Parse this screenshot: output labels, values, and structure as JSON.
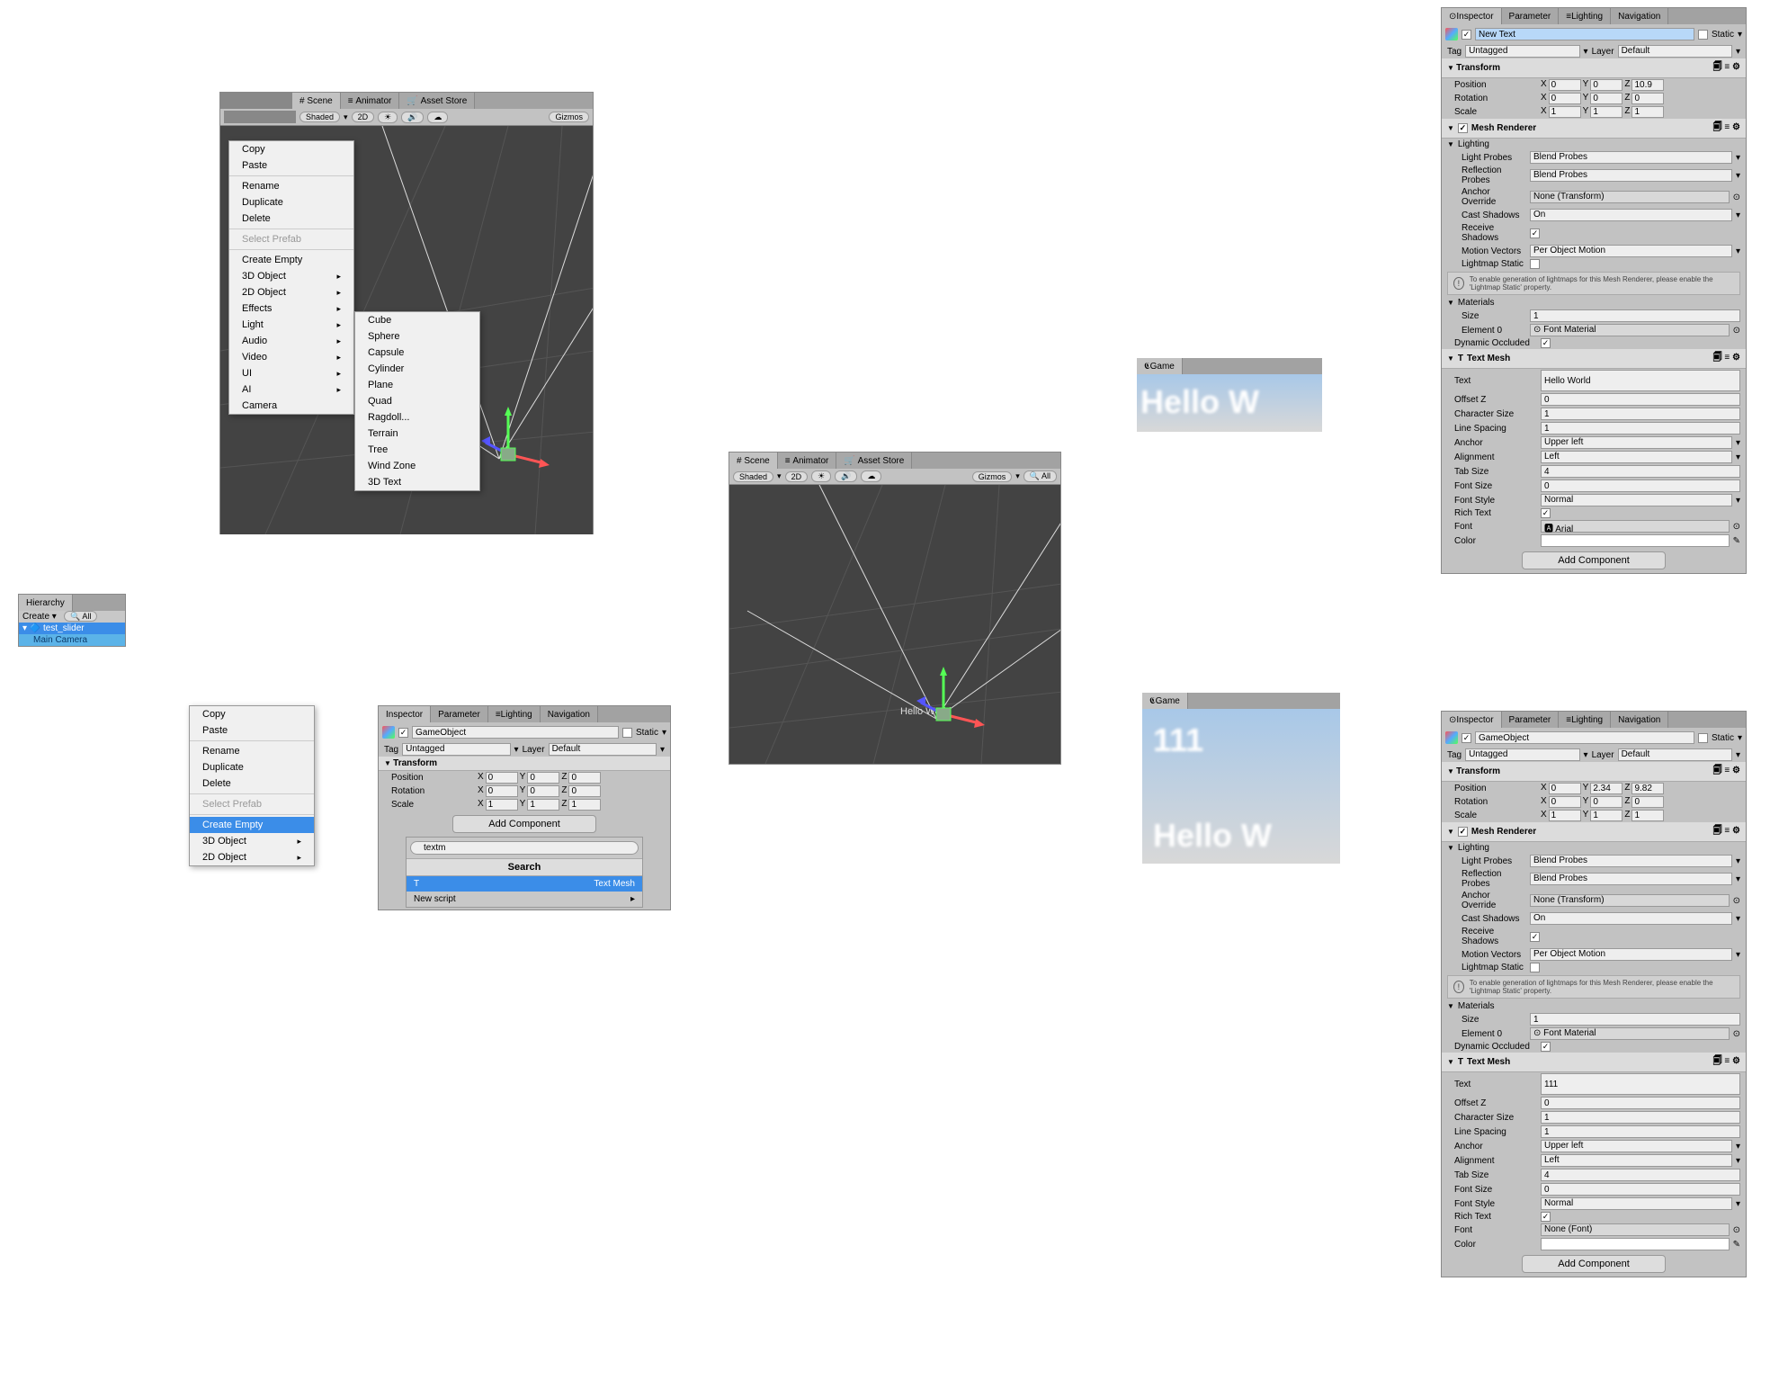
{
  "hierarchy": {
    "title": "Hierarchy",
    "create": "Create",
    "root": "test_slider",
    "camera": "Main Camera"
  },
  "sceneTabs": {
    "scene": "Scene",
    "animator": "Animator",
    "asset": "Asset Store",
    "shaded": "Shaded",
    "mode2d": "2D",
    "gizmos": "Gizmos"
  },
  "ctxMenu1": {
    "copy": "Copy",
    "paste": "Paste",
    "rename": "Rename",
    "duplicate": "Duplicate",
    "delete": "Delete",
    "selectPrefab": "Select Prefab",
    "createEmpty": "Create Empty",
    "obj3d": "3D Object",
    "obj2d": "2D Object",
    "effects": "Effects",
    "light": "Light",
    "audio": "Audio",
    "video": "Video",
    "ui": "UI",
    "ai": "AI",
    "camera": "Camera"
  },
  "subMenu3d": {
    "cube": "Cube",
    "sphere": "Sphere",
    "capsule": "Capsule",
    "cylinder": "Cylinder",
    "plane": "Plane",
    "quad": "Quad",
    "ragdoll": "Ragdoll...",
    "terrain": "Terrain",
    "tree": "Tree",
    "windzone": "Wind Zone",
    "text3d": "3D Text"
  },
  "ctxMenu2": {
    "copy": "Copy",
    "paste": "Paste",
    "rename": "Rename",
    "duplicate": "Duplicate",
    "delete": "Delete",
    "selectPrefab": "Select Prefab",
    "createEmpty": "Create Empty",
    "obj3d": "3D Object",
    "obj2d": "2D Object"
  },
  "sceneText": "Hello World",
  "gameTab": "Game",
  "gamePreview1": "Hello W",
  "gamePreview2a": "111",
  "gamePreview2b": "Hello W",
  "inspTabs": {
    "inspector": "Inspector",
    "parameter": "Parameter",
    "lighting": "Lighting",
    "navigation": "Navigation"
  },
  "inspA": {
    "name": "GameObject",
    "static": "Static",
    "tag": "Tag",
    "tagVal": "Untagged",
    "layer": "Layer",
    "layerVal": "Default",
    "transform": "Transform",
    "position": "Position",
    "rotation": "Rotation",
    "scale": "Scale",
    "pos": {
      "x": "0",
      "y": "0",
      "z": "0"
    },
    "rot": {
      "x": "0",
      "y": "0",
      "z": "0"
    },
    "scl": {
      "x": "1",
      "y": "1",
      "z": "1"
    },
    "addComponent": "Add Component",
    "searchVal": "textm",
    "searchHdr": "Search",
    "textMesh": "Text Mesh",
    "newScript": "New script"
  },
  "inspB": {
    "name": "New Text",
    "static": "Static",
    "tag": "Tag",
    "tagVal": "Untagged",
    "layer": "Layer",
    "layerVal": "Default",
    "transform": "Transform",
    "position": "Position",
    "rotation": "Rotation",
    "scale": "Scale",
    "pos": {
      "x": "0",
      "y": "0",
      "z": "10.9"
    },
    "rot": {
      "x": "0",
      "y": "0",
      "z": "0"
    },
    "scl": {
      "x": "1",
      "y": "1",
      "z": "1"
    },
    "meshRenderer": "Mesh Renderer",
    "lighting": "Lighting",
    "lightProbes": "Light Probes",
    "lightProbesVal": "Blend Probes",
    "reflProbes": "Reflection Probes",
    "reflProbesVal": "Blend Probes",
    "anchorOverride": "Anchor Override",
    "anchorOverrideVal": "None (Transform)",
    "castShadows": "Cast Shadows",
    "castShadowsVal": "On",
    "receiveShadows": "Receive Shadows",
    "motionVectors": "Motion Vectors",
    "motionVectorsVal": "Per Object Motion",
    "lightmapStatic": "Lightmap Static",
    "hint": "To enable generation of lightmaps for this Mesh Renderer, please enable the 'Lightmap Static' property.",
    "materials": "Materials",
    "size": "Size",
    "sizeVal": "1",
    "element0": "Element 0",
    "element0Val": "Font Material",
    "dynOccluded": "Dynamic Occluded",
    "textMeshHdr": "Text Mesh",
    "text": "Text",
    "textVal": "Hello World",
    "offsetZ": "Offset Z",
    "offsetZVal": "0",
    "charSize": "Character Size",
    "charSizeVal": "1",
    "lineSpacing": "Line Spacing",
    "lineSpacingVal": "1",
    "anchor": "Anchor",
    "anchorVal": "Upper left",
    "alignment": "Alignment",
    "alignmentVal": "Left",
    "tabSize": "Tab Size",
    "tabSizeVal": "4",
    "fontSize": "Font Size",
    "fontSizeVal": "0",
    "fontStyle": "Font Style",
    "fontStyleVal": "Normal",
    "richText": "Rich Text",
    "font": "Font",
    "fontVal": "Arial",
    "color": "Color",
    "addComponent": "Add Component"
  },
  "inspC": {
    "name": "GameObject",
    "static": "Static",
    "tag": "Tag",
    "tagVal": "Untagged",
    "layer": "Layer",
    "layerVal": "Default",
    "transform": "Transform",
    "position": "Position",
    "rotation": "Rotation",
    "scale": "Scale",
    "pos": {
      "x": "0",
      "y": "2.34",
      "z": "9.82"
    },
    "rot": {
      "x": "0",
      "y": "0",
      "z": "0"
    },
    "scl": {
      "x": "1",
      "y": "1",
      "z": "1"
    },
    "meshRenderer": "Mesh Renderer",
    "lighting": "Lighting",
    "lightProbes": "Light Probes",
    "lightProbesVal": "Blend Probes",
    "reflProbes": "Reflection Probes",
    "reflProbesVal": "Blend Probes",
    "anchorOverride": "Anchor Override",
    "anchorOverrideVal": "None (Transform)",
    "castShadows": "Cast Shadows",
    "castShadowsVal": "On",
    "receiveShadows": "Receive Shadows",
    "motionVectors": "Motion Vectors",
    "motionVectorsVal": "Per Object Motion",
    "lightmapStatic": "Lightmap Static",
    "hint": "To enable generation of lightmaps for this Mesh Renderer, please enable the 'Lightmap Static' property.",
    "materials": "Materials",
    "size": "Size",
    "sizeVal": "1",
    "element0": "Element 0",
    "element0Val": "Font Material",
    "dynOccluded": "Dynamic Occluded",
    "textMeshHdr": "Text Mesh",
    "text": "Text",
    "textVal": "111",
    "offsetZ": "Offset Z",
    "offsetZVal": "0",
    "charSize": "Character Size",
    "charSizeVal": "1",
    "lineSpacing": "Line Spacing",
    "lineSpacingVal": "1",
    "anchor": "Anchor",
    "anchorVal": "Upper left",
    "alignment": "Alignment",
    "alignmentVal": "Left",
    "tabSize": "Tab Size",
    "tabSizeVal": "4",
    "fontSize": "Font Size",
    "fontSizeVal": "0",
    "fontStyle": "Font Style",
    "fontStyleVal": "Normal",
    "richText": "Rich Text",
    "font": "Font",
    "fontVal": "None (Font)",
    "color": "Color",
    "addComponent": "Add Component"
  }
}
